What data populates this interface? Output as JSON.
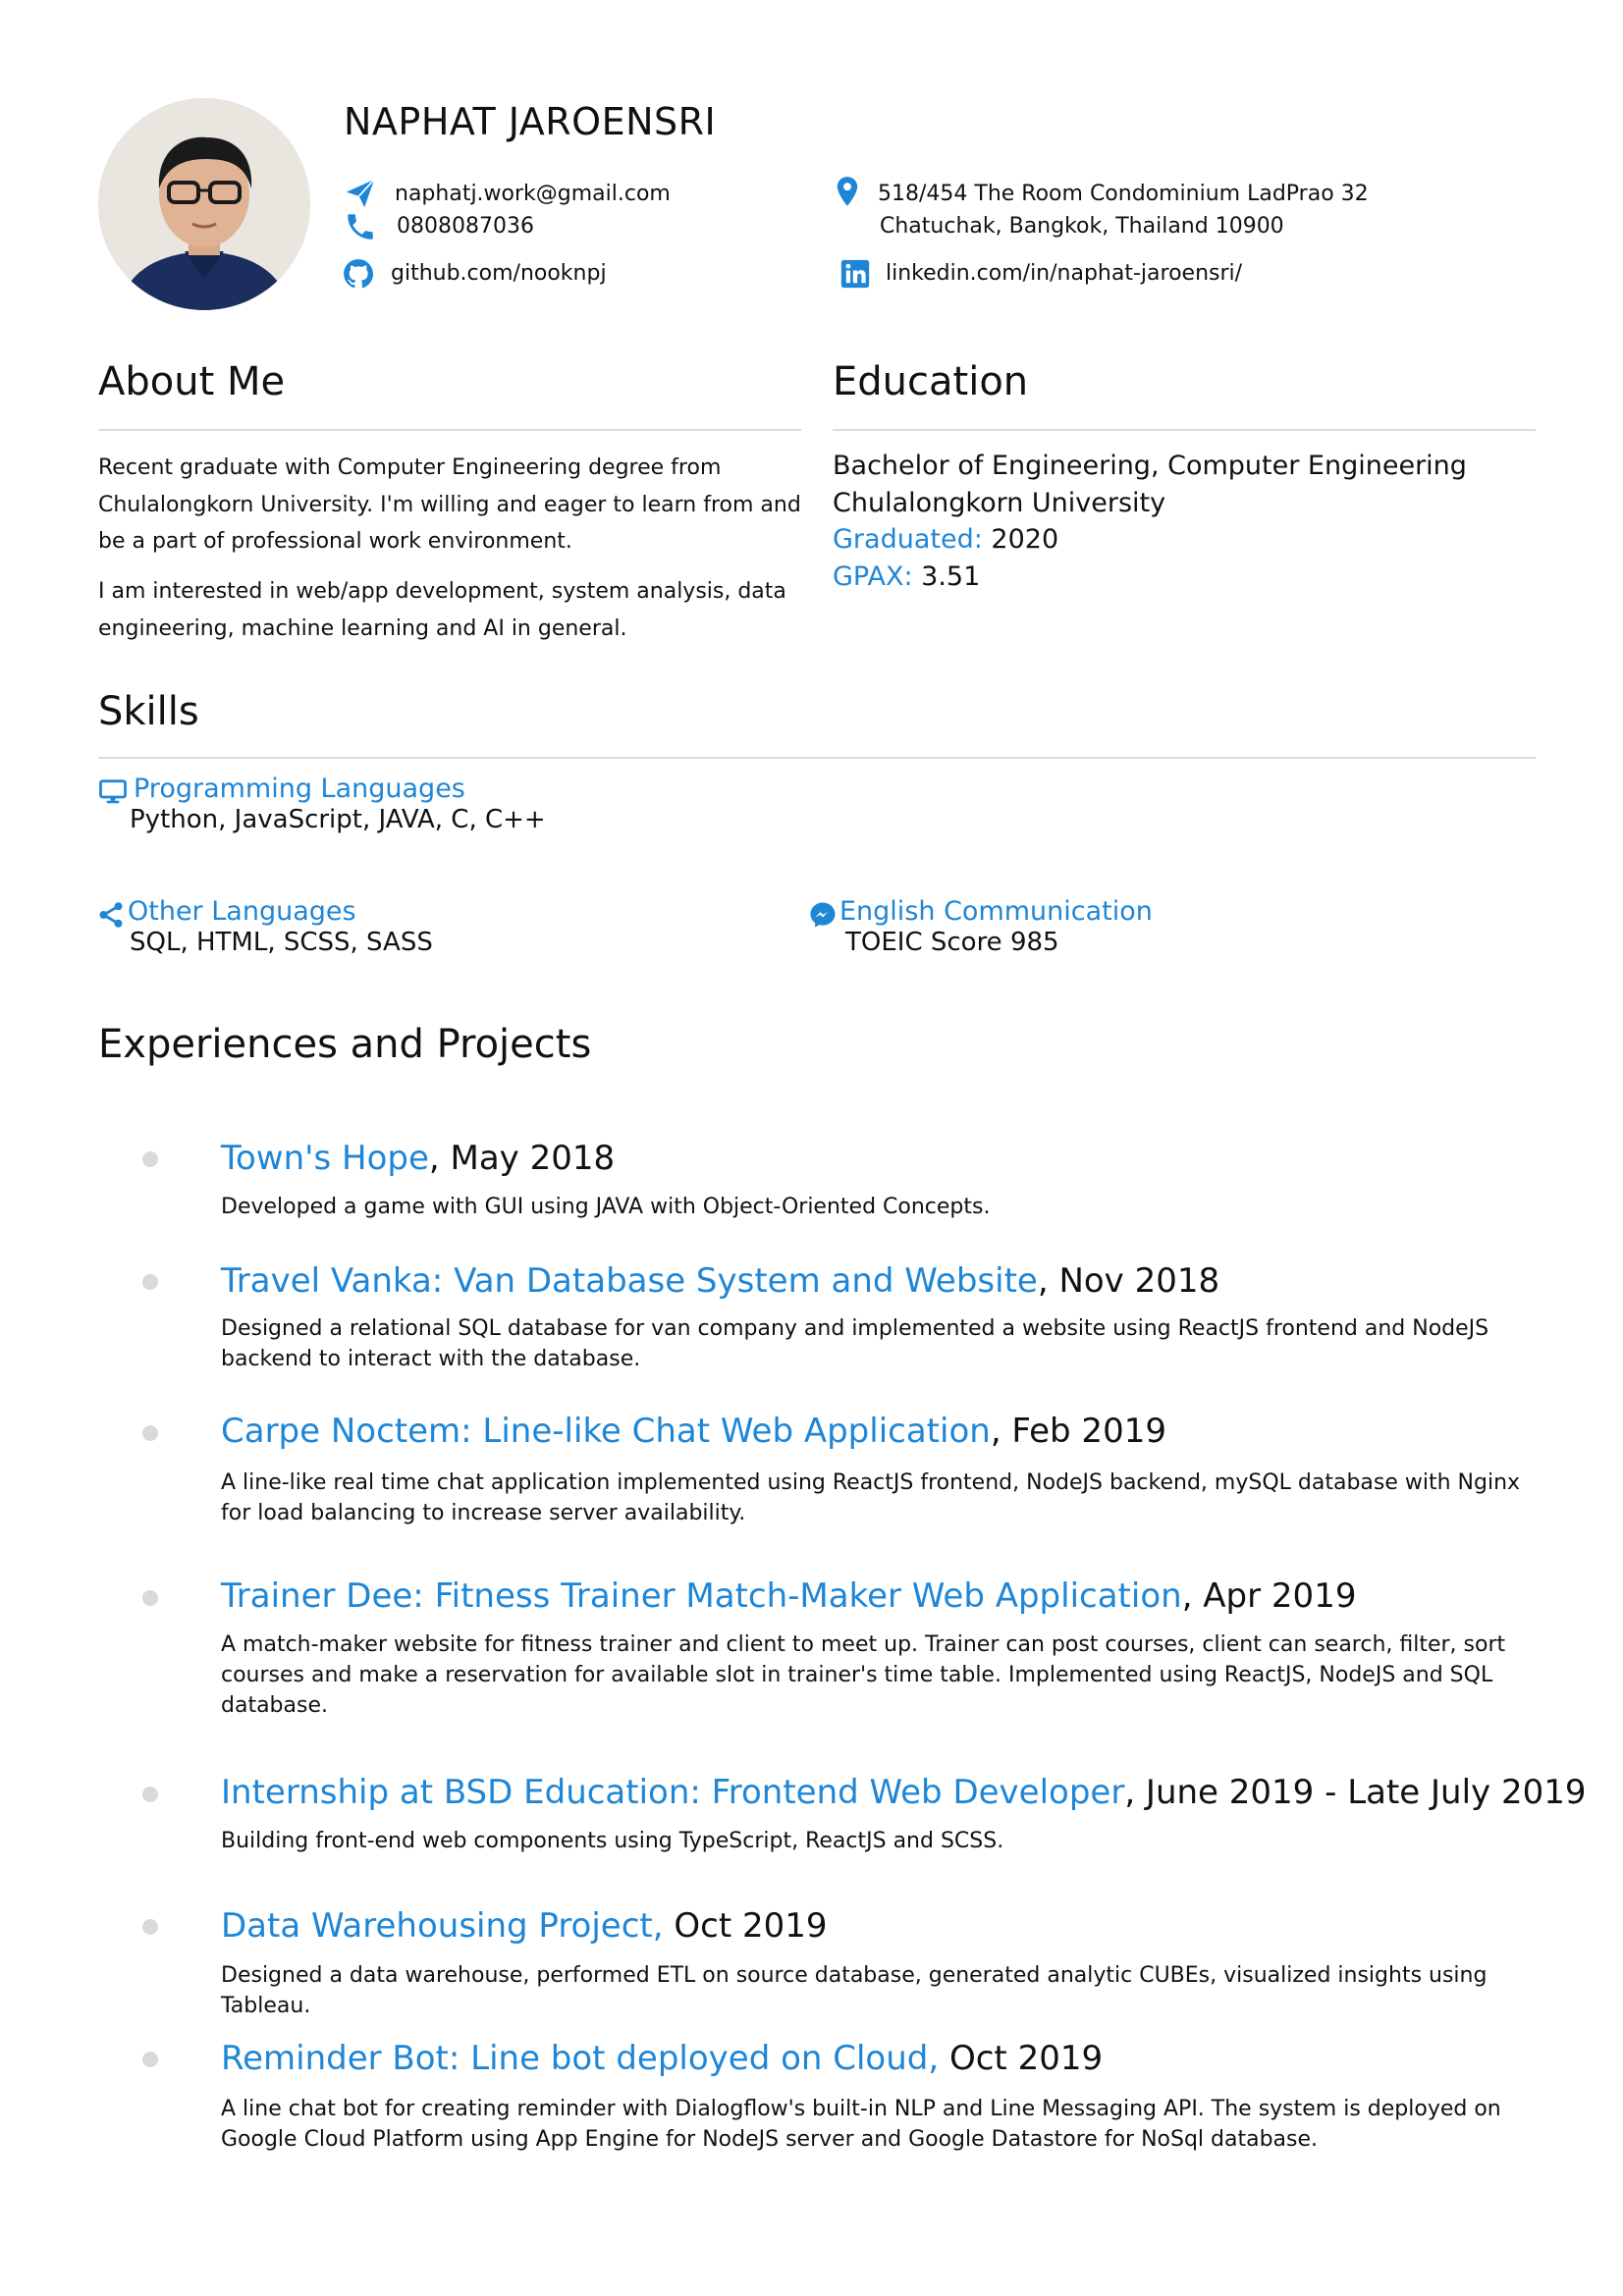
{
  "header": {
    "name": "NAPHAT JAROENSRI",
    "email": "naphatj.work@gmail.com",
    "phone": "0808087036",
    "github": "github.com/nooknpj",
    "address_line1": "518/454 The Room Condominium LadPrao 32",
    "address_line2": "Chatuchak, Bangkok, Thailand 10900",
    "linkedin": "linkedin.com/in/naphat-jaroensri/"
  },
  "about": {
    "title": "About Me",
    "p1": "Recent graduate with Computer Engineering  degree from Chulalongkorn University. I'm willing and eager to learn from and be a part of professional work environment.",
    "p2": "I am interested in web/app development, system analysis, data engineering, machine learning and AI in general."
  },
  "education": {
    "title": "Education",
    "degree": "Bachelor of Engineering, Computer Engineering",
    "university": "Chulalongkorn University",
    "graduated_label": "Graduated:",
    "graduated_value": "2020",
    "gpax_label": "GPAX:",
    "gpax_value": "3.51"
  },
  "skills": {
    "title": "Skills",
    "programming": {
      "label": "Programming Languages",
      "value": "Python, JavaScript, JAVA, C, C++"
    },
    "other": {
      "label": "Other Languages",
      "value": "SQL, HTML, SCSS, SASS"
    },
    "english": {
      "label": "English Communication",
      "value": "TOEIC Score 985"
    }
  },
  "experiences": {
    "title": "Experiences and Projects",
    "items": [
      {
        "title": "Town's Hope",
        "date": ", May 2018",
        "desc": "Developed a game with GUI using JAVA with Object-Oriented Concepts."
      },
      {
        "title": "Travel Vanka: Van Database System and Website",
        "date": ", Nov 2018",
        "desc": "Designed a relational SQL database for van company and implemented a website using ReactJS frontend and NodeJS backend to interact with the database."
      },
      {
        "title": "Carpe Noctem: Line-like Chat Web Application",
        "date": ", Feb 2019",
        "desc": "A line-like real time chat application implemented using ReactJS frontend, NodeJS backend, mySQL database with Nginx for load balancing to increase server availability."
      },
      {
        "title": "Trainer Dee: Fitness Trainer Match-Maker Web Application",
        "date": ", Apr 2019",
        "desc": "A match-maker website for fitness trainer and client to meet up. Trainer can post courses, client can search, filter, sort courses and make a reservation for available slot in trainer's time table. Implemented using ReactJS, NodeJS and SQL database."
      },
      {
        "title": "Internship at BSD Education: Frontend Web Developer",
        "date": ", June 2019 - Late July 2019",
        "desc": "Building front-end web components using TypeScript, ReactJS and SCSS."
      },
      {
        "title": "Data Warehousing Project,",
        "date": " Oct 2019",
        "desc": "Designed a data warehouse, performed ETL on source database, generated analytic CUBEs, visualized insights using Tableau."
      },
      {
        "title": "Reminder Bot: Line bot deployed on Cloud,",
        "date": " Oct 2019",
        "desc": "A line chat bot for creating reminder with Dialogflow's built-in NLP and Line Messaging API. The system is deployed on Google Cloud Platform using App Engine for NodeJS server and Google Datastore for NoSql database."
      }
    ]
  },
  "colors": {
    "accent": "#1f86d6",
    "link": "#10a26b",
    "rule": "#dcdcdc",
    "bullet": "#d9d9d9"
  },
  "icons": [
    "paper-plane-icon",
    "phone-icon",
    "github-icon",
    "map-pin-icon",
    "linkedin-icon",
    "monitor-icon",
    "share-icon",
    "messenger-icon"
  ]
}
